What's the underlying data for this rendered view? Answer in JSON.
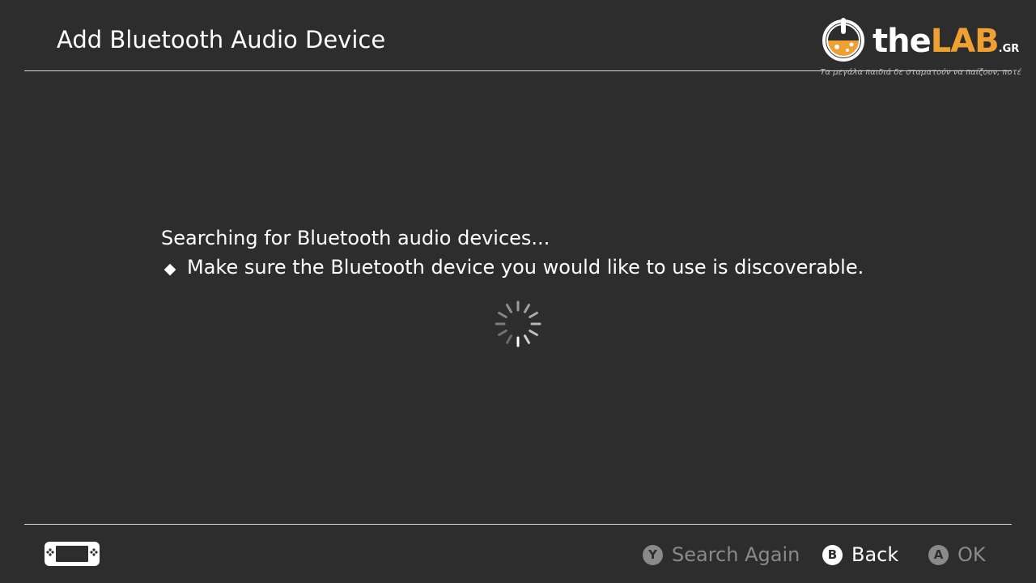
{
  "header": {
    "title": "Add Bluetooth Audio Device"
  },
  "watermark": {
    "word_the": "the",
    "word_lab": "LAB",
    "word_suffix": ".GR",
    "tagline": "Τα μεγάλα παιδιά δε σταματούν να παίζουν, ποτέ",
    "accent_color": "#f0a030"
  },
  "message": {
    "status": "Searching for Bluetooth audio devices...",
    "hint_icon": "diamond-bullet-icon",
    "hint": "Make sure the Bluetooth device you would like to use is discoverable."
  },
  "spinner": {
    "icon": "loading-spinner-icon"
  },
  "footer": {
    "console_icon": "handheld-console-icon",
    "buttons": [
      {
        "glyph": "Y",
        "label": "Search Again",
        "state": "disabled"
      },
      {
        "glyph": "B",
        "label": "Back",
        "state": "enabled"
      },
      {
        "glyph": "A",
        "label": "OK",
        "state": "disabled"
      }
    ]
  },
  "colors": {
    "background": "#2d2d2d",
    "text": "#ffffff",
    "disabled_text": "#8a8a8a",
    "divider": "#d6d6d6"
  }
}
